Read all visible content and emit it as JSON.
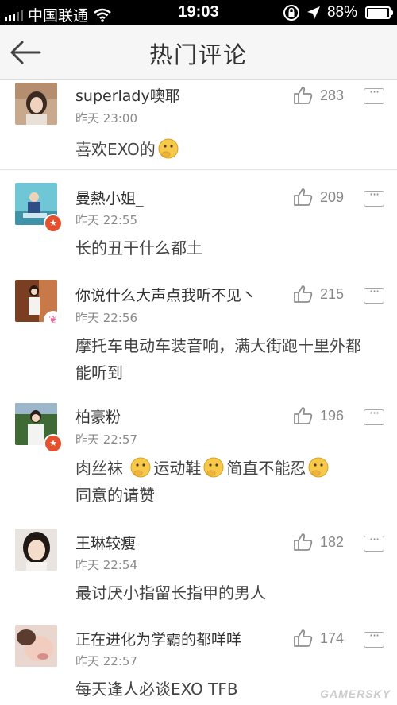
{
  "status_bar": {
    "carrier": "中国联通",
    "time": "19:03",
    "battery": "88%",
    "battery_level": 0.88,
    "icons": [
      "signal-icon",
      "wifi-icon",
      "rotation-lock-icon",
      "location-arrow-icon",
      "battery-icon"
    ]
  },
  "nav": {
    "title": "热门评论",
    "back_icon": "back-arrow-icon"
  },
  "comments": [
    {
      "user": "superlady噢耶",
      "time": "昨天 23:00",
      "text": "喜欢EXO的",
      "likes": "283",
      "badge": ""
    },
    {
      "user": "曼熱小姐_",
      "time": "昨天 22:55",
      "text": "长的丑干什么都土",
      "likes": "209",
      "badge": "star"
    },
    {
      "user": "你说什么大声点我听不见丶",
      "time": "昨天 22:56",
      "text": "摩托车电动车装音响，满大街跑十里外都能听到",
      "likes": "215",
      "badge": "bunny"
    },
    {
      "user": "柏豪粉",
      "time": "昨天 22:57",
      "text": "肉丝袜 运动鞋 简直不能忍 同意的请赞",
      "likes": "196",
      "badge": "star"
    },
    {
      "user": "王琳较瘦",
      "time": "昨天 22:54",
      "text": "最讨厌小指留长指甲的男人",
      "likes": "182",
      "badge": ""
    },
    {
      "user": "正在进化为学霸的都咩咩",
      "time": "昨天 22:57",
      "text": "每天逢人必谈EXO TFB",
      "likes": "174",
      "badge": ""
    }
  ],
  "watermark": "GAMERSKY"
}
